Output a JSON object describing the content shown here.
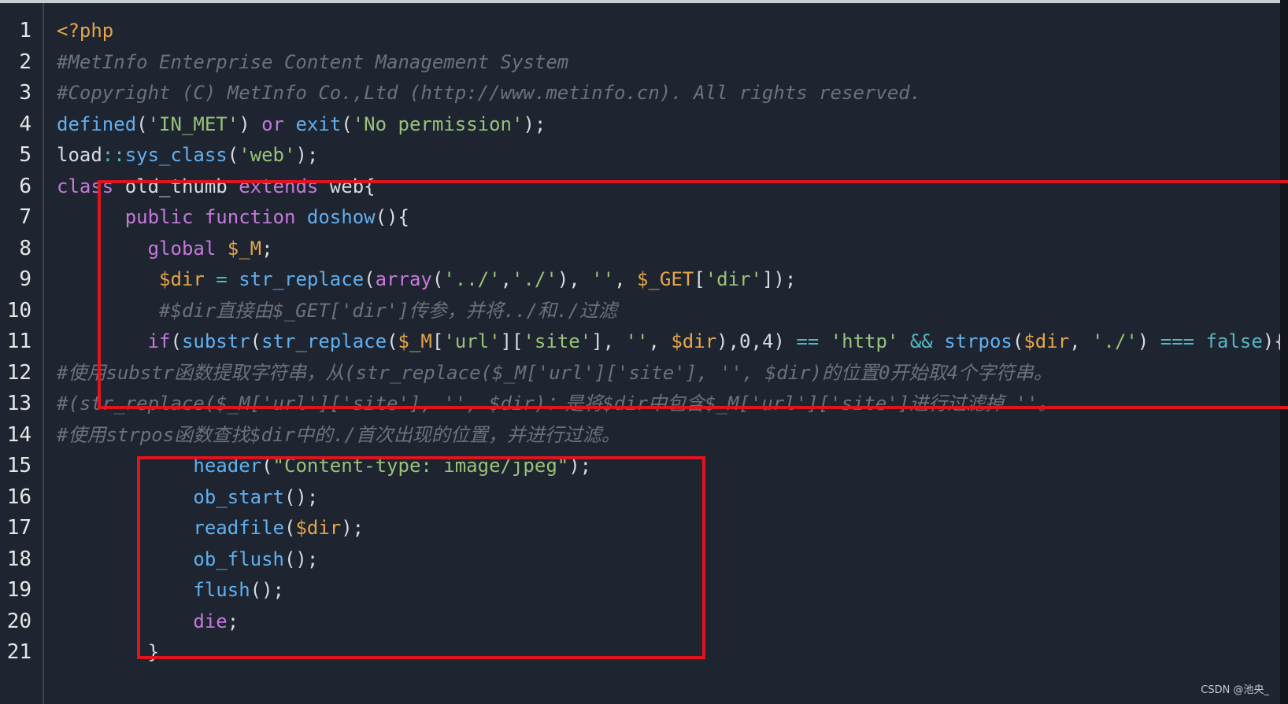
{
  "colors": {
    "background": "#1e2530",
    "comment": "#6b717d",
    "keyword": "#c678dd",
    "function": "#61afef",
    "string": "#98c379",
    "variable": "#e5a54b",
    "operator": "#56b6c2",
    "highlight_box": "#e1141e"
  },
  "lines": [
    {
      "num": "1",
      "tokens": [
        {
          "t": "<?php",
          "c": "phptag"
        }
      ]
    },
    {
      "num": "2",
      "tokens": [
        {
          "t": "#MetInfo Enterprise Content Management System",
          "c": "comment"
        }
      ]
    },
    {
      "num": "3",
      "tokens": [
        {
          "t": "#Copyright (C) MetInfo Co.,Ltd (http://www.metinfo.cn). All rights reserved.",
          "c": "comment"
        }
      ]
    },
    {
      "num": "4",
      "tokens": [
        {
          "t": "defined",
          "c": "function"
        },
        {
          "t": "(",
          "c": "default"
        },
        {
          "t": "'IN_MET'",
          "c": "string"
        },
        {
          "t": ") ",
          "c": "default"
        },
        {
          "t": "or",
          "c": "keyword"
        },
        {
          "t": " ",
          "c": "default"
        },
        {
          "t": "exit",
          "c": "function"
        },
        {
          "t": "(",
          "c": "default"
        },
        {
          "t": "'No permission'",
          "c": "string"
        },
        {
          "t": ");",
          "c": "default"
        }
      ]
    },
    {
      "num": "5",
      "tokens": [
        {
          "t": "load",
          "c": "default"
        },
        {
          "t": "::",
          "c": "operator"
        },
        {
          "t": "sys_class",
          "c": "function"
        },
        {
          "t": "(",
          "c": "default"
        },
        {
          "t": "'web'",
          "c": "string"
        },
        {
          "t": ");",
          "c": "default"
        }
      ]
    },
    {
      "num": "6",
      "tokens": [
        {
          "t": "class",
          "c": "keyword"
        },
        {
          "t": " old_thumb ",
          "c": "default"
        },
        {
          "t": "extends",
          "c": "keyword"
        },
        {
          "t": " web{",
          "c": "default"
        }
      ]
    },
    {
      "num": "7",
      "tokens": [
        {
          "t": "      ",
          "c": "default"
        },
        {
          "t": "public",
          "c": "keyword"
        },
        {
          "t": " ",
          "c": "default"
        },
        {
          "t": "function",
          "c": "keyword"
        },
        {
          "t": " ",
          "c": "default"
        },
        {
          "t": "doshow",
          "c": "function"
        },
        {
          "t": "(){",
          "c": "default"
        }
      ]
    },
    {
      "num": "8",
      "tokens": [
        {
          "t": "        ",
          "c": "default"
        },
        {
          "t": "global",
          "c": "keyword"
        },
        {
          "t": " ",
          "c": "default"
        },
        {
          "t": "$_M",
          "c": "variable"
        },
        {
          "t": ";",
          "c": "default"
        }
      ]
    },
    {
      "num": "9",
      "tokens": [
        {
          "t": "         ",
          "c": "default"
        },
        {
          "t": "$dir",
          "c": "variable"
        },
        {
          "t": " ",
          "c": "default"
        },
        {
          "t": "=",
          "c": "operator"
        },
        {
          "t": " ",
          "c": "default"
        },
        {
          "t": "str_replace",
          "c": "function"
        },
        {
          "t": "(",
          "c": "default"
        },
        {
          "t": "array",
          "c": "keyword"
        },
        {
          "t": "(",
          "c": "default"
        },
        {
          "t": "'../'",
          "c": "string"
        },
        {
          "t": ",",
          "c": "default"
        },
        {
          "t": "'./'",
          "c": "string"
        },
        {
          "t": "), ",
          "c": "default"
        },
        {
          "t": "''",
          "c": "string"
        },
        {
          "t": ", ",
          "c": "default"
        },
        {
          "t": "$_GET",
          "c": "variable"
        },
        {
          "t": "[",
          "c": "default"
        },
        {
          "t": "'dir'",
          "c": "string"
        },
        {
          "t": "]);",
          "c": "default"
        }
      ]
    },
    {
      "num": "10",
      "tokens": [
        {
          "t": "         ",
          "c": "default"
        },
        {
          "t": "#$dir直接由$_GET['dir']传参，并将../和./过滤",
          "c": "comment"
        }
      ]
    },
    {
      "num": "11",
      "tokens": [
        {
          "t": "        ",
          "c": "default"
        },
        {
          "t": "if",
          "c": "keyword"
        },
        {
          "t": "(",
          "c": "default"
        },
        {
          "t": "substr",
          "c": "function"
        },
        {
          "t": "(",
          "c": "default"
        },
        {
          "t": "str_replace",
          "c": "function"
        },
        {
          "t": "(",
          "c": "default"
        },
        {
          "t": "$_M",
          "c": "variable"
        },
        {
          "t": "[",
          "c": "default"
        },
        {
          "t": "'url'",
          "c": "string"
        },
        {
          "t": "][",
          "c": "default"
        },
        {
          "t": "'site'",
          "c": "string"
        },
        {
          "t": "], ",
          "c": "default"
        },
        {
          "t": "''",
          "c": "string"
        },
        {
          "t": ", ",
          "c": "default"
        },
        {
          "t": "$dir",
          "c": "variable"
        },
        {
          "t": "),0,4) ",
          "c": "default"
        },
        {
          "t": "==",
          "c": "operator"
        },
        {
          "t": " ",
          "c": "default"
        },
        {
          "t": "'http'",
          "c": "string"
        },
        {
          "t": " ",
          "c": "default"
        },
        {
          "t": "&&",
          "c": "operator"
        },
        {
          "t": " ",
          "c": "default"
        },
        {
          "t": "strpos",
          "c": "function"
        },
        {
          "t": "(",
          "c": "default"
        },
        {
          "t": "$dir",
          "c": "variable"
        },
        {
          "t": ", ",
          "c": "default"
        },
        {
          "t": "'./'",
          "c": "string"
        },
        {
          "t": ") ",
          "c": "default"
        },
        {
          "t": "===",
          "c": "operator"
        },
        {
          "t": " ",
          "c": "default"
        },
        {
          "t": "false",
          "c": "const"
        },
        {
          "t": "){",
          "c": "default"
        }
      ]
    },
    {
      "num": "12",
      "tokens": [
        {
          "t": "#使用substr函数提取字符串，从(str_replace($_M['url']['site'], '', $dir)的位置0开始取4个字符串。",
          "c": "comment"
        }
      ]
    },
    {
      "num": "13",
      "tokens": [
        {
          "t": "#(str_replace($_M['url']['site'], '', $dir)：是将$dir中包含$_M['url']['site']进行过滤掉 ''。",
          "c": "comment"
        }
      ]
    },
    {
      "num": "14",
      "tokens": [
        {
          "t": "#使用strpos函数查找$dir中的./首次出现的位置，并进行过滤。",
          "c": "comment"
        }
      ]
    },
    {
      "num": "15",
      "tokens": [
        {
          "t": "            ",
          "c": "default"
        },
        {
          "t": "header",
          "c": "function"
        },
        {
          "t": "(",
          "c": "default"
        },
        {
          "t": "\"Content-type: image/jpeg\"",
          "c": "string"
        },
        {
          "t": ");",
          "c": "default"
        }
      ]
    },
    {
      "num": "16",
      "tokens": [
        {
          "t": "            ",
          "c": "default"
        },
        {
          "t": "ob_start",
          "c": "function"
        },
        {
          "t": "();",
          "c": "default"
        }
      ]
    },
    {
      "num": "17",
      "tokens": [
        {
          "t": "            ",
          "c": "default"
        },
        {
          "t": "readfile",
          "c": "function"
        },
        {
          "t": "(",
          "c": "default"
        },
        {
          "t": "$dir",
          "c": "variable"
        },
        {
          "t": ");",
          "c": "default"
        }
      ]
    },
    {
      "num": "18",
      "tokens": [
        {
          "t": "            ",
          "c": "default"
        },
        {
          "t": "ob_flush",
          "c": "function"
        },
        {
          "t": "();",
          "c": "default"
        }
      ]
    },
    {
      "num": "19",
      "tokens": [
        {
          "t": "            ",
          "c": "default"
        },
        {
          "t": "flush",
          "c": "function"
        },
        {
          "t": "();",
          "c": "default"
        }
      ]
    },
    {
      "num": "20",
      "tokens": [
        {
          "t": "            ",
          "c": "default"
        },
        {
          "t": "die",
          "c": "keyword"
        },
        {
          "t": ";",
          "c": "default"
        }
      ]
    },
    {
      "num": "21",
      "tokens": [
        {
          "t": "        ",
          "c": "default"
        },
        {
          "t": "}",
          "c": "default"
        }
      ]
    }
  ],
  "watermark": "CSDN @池央_"
}
